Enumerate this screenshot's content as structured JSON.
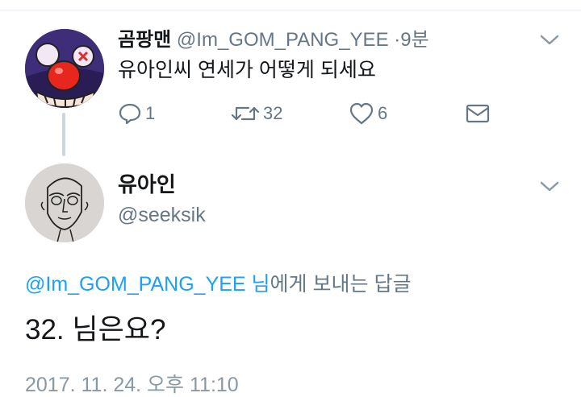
{
  "tweet": {
    "name": "곰팡맨",
    "handle": "@Im_GOM_PANG_YEE",
    "separator": "·",
    "time": "9분",
    "text": "유아인씨 연세가 어떻게 되세요",
    "actions": {
      "reply_count": "1",
      "retweet_count": "32",
      "like_count": "6"
    }
  },
  "reply": {
    "name": "유아인",
    "handle": "@seeksik",
    "reply_to_link": "@Im_GOM_PANG_YEE 님",
    "reply_to_suffix": "에게 보내는 답글",
    "text": "32. 님은요?",
    "timestamp": "2017. 11. 24. 오후 11:10"
  },
  "icons": {
    "reply": "reply-icon",
    "retweet": "retweet-icon",
    "like": "heart-icon",
    "dm": "envelope-icon",
    "menu": "chevron-down-icon"
  },
  "colors": {
    "link": "#1da1f2",
    "muted": "#657786",
    "text": "#14171a",
    "thread_line": "#ccd6dd"
  }
}
